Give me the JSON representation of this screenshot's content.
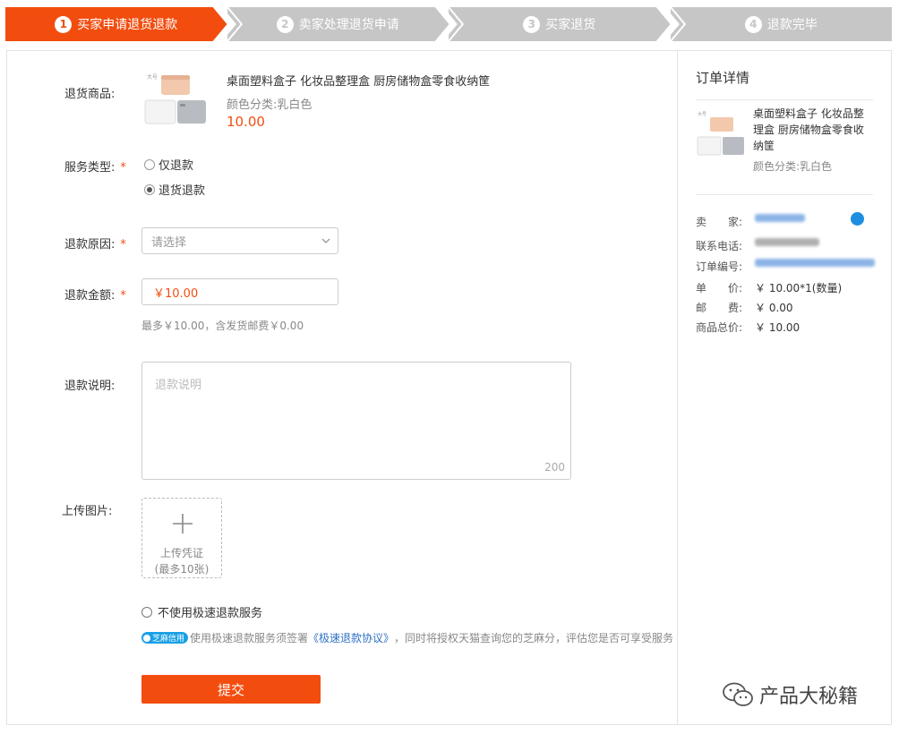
{
  "steps": [
    {
      "num": "1",
      "label": "买家申请退货退款",
      "active": true
    },
    {
      "num": "2",
      "label": "卖家处理退货申请",
      "active": false
    },
    {
      "num": "3",
      "label": "买家退货",
      "active": false
    },
    {
      "num": "4",
      "label": "退款完毕",
      "active": false
    }
  ],
  "colors": {
    "accent": "#f24d0f",
    "step_inactive": "#c6c6c6",
    "link": "#2f72c4"
  },
  "form": {
    "goods_label": "退货商品:",
    "goods_title": "桌面塑料盒子 化妆品整理盒 厨房储物盒零食收纳筐",
    "goods_spec": "颜色分类:乳白色",
    "goods_price": "10.00",
    "service_label": "服务类型:",
    "required_mark": "*",
    "service_options": [
      "仅退款",
      "退货退款"
    ],
    "service_selected": "退货退款",
    "reason_label": "退款原因:",
    "reason_placeholder": "请选择",
    "amount_label": "退款金额:",
    "amount_value": "￥10.00",
    "amount_hint": "最多￥10.00，含发货邮费￥0.00",
    "desc_label": "退款说明:",
    "desc_placeholder": "退款说明",
    "desc_count": "200",
    "upload_label": "上传图片:",
    "upload_text": "上传凭证",
    "upload_limit": "(最多10张)",
    "fast_refund_option": "不使用极速退款服务",
    "zhima_badge": "芝麻信用",
    "agree_prefix": "使用极速退款服务须签署",
    "agree_link": "《极速退款协议》",
    "agree_suffix": "，同时将授权天猫查询您的芝麻分，评估您是否可享受服务",
    "submit_label": "提交"
  },
  "order": {
    "title": "订单详情",
    "goods_title": "桌面塑料盒子 化妆品整理盒 厨房储物盒零食收纳筐",
    "goods_spec": "颜色分类:乳白色",
    "rows": [
      {
        "key": "卖　　家:",
        "value": "",
        "blurred": true
      },
      {
        "key": "联系电话:",
        "value": "",
        "blurred": true
      },
      {
        "key": "订单编号:",
        "value": "",
        "blurred": true
      },
      {
        "key": "单　　价:",
        "value": "￥ 10.00*1(数量)"
      },
      {
        "key": "邮　　费:",
        "value": "￥ 0.00"
      },
      {
        "key": "商品总价:",
        "value": "￥ 10.00"
      }
    ]
  },
  "watermark": {
    "text": "产品大秘籍",
    "icon": "wechat-icon"
  }
}
